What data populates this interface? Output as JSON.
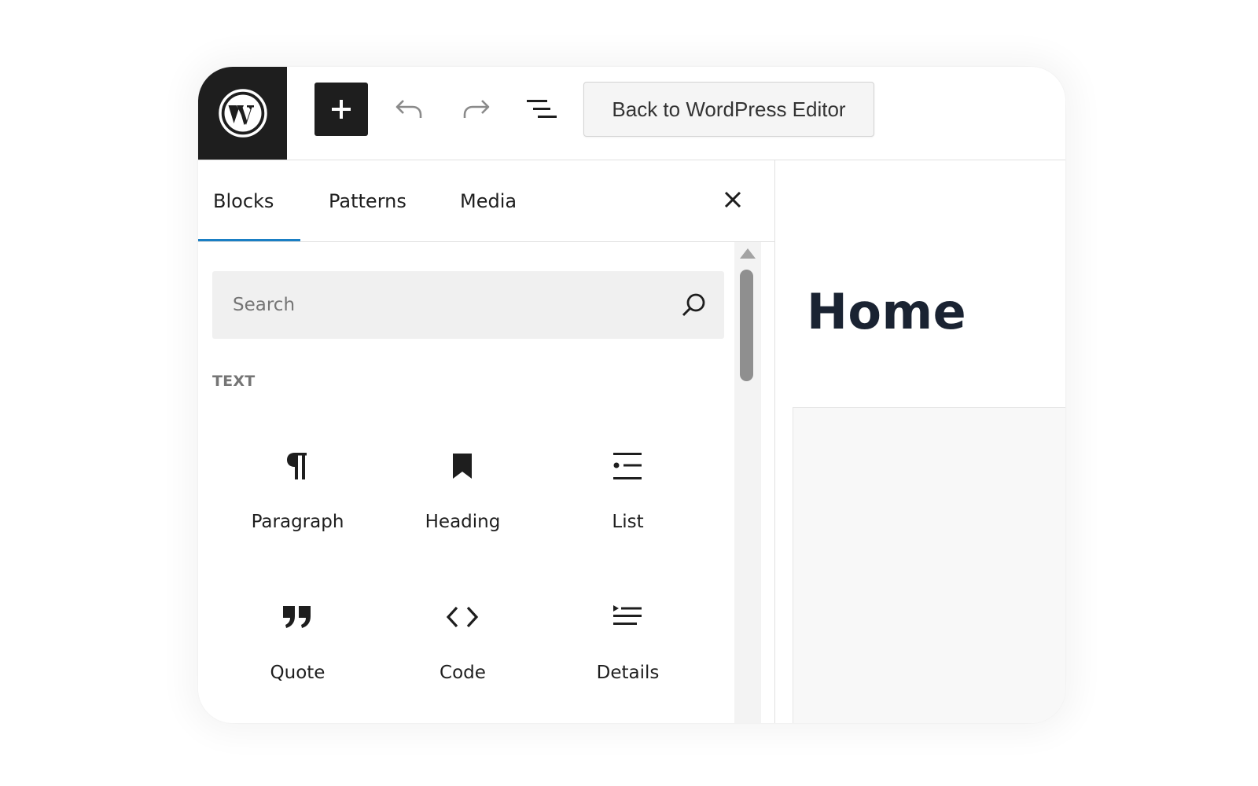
{
  "toolbar": {
    "logo_icon": "wordpress-logo-icon",
    "add_icon": "plus-icon",
    "undo_icon": "undo-icon",
    "redo_icon": "redo-icon",
    "outline_icon": "document-overview-icon",
    "back_label": "Back to WordPress Editor"
  },
  "inserter": {
    "tabs": [
      {
        "label": "Blocks",
        "active": true
      },
      {
        "label": "Patterns",
        "active": false
      },
      {
        "label": "Media",
        "active": false
      }
    ],
    "close_icon": "close-icon",
    "search": {
      "placeholder": "Search",
      "value": "",
      "icon": "search-icon"
    },
    "section_title": "TEXT",
    "blocks": [
      {
        "label": "Paragraph",
        "icon": "paragraph-icon"
      },
      {
        "label": "Heading",
        "icon": "heading-bookmark-icon"
      },
      {
        "label": "List",
        "icon": "list-icon"
      },
      {
        "label": "Quote",
        "icon": "quote-icon"
      },
      {
        "label": "Code",
        "icon": "code-icon"
      },
      {
        "label": "Details",
        "icon": "details-icon"
      }
    ]
  },
  "canvas": {
    "page_title": "Home"
  },
  "colors": {
    "dark": "#1e1e1e",
    "accent": "#1a7fc4",
    "muted_text": "#757575",
    "search_bg": "#f0f0f0",
    "title_color": "#1a2332"
  }
}
